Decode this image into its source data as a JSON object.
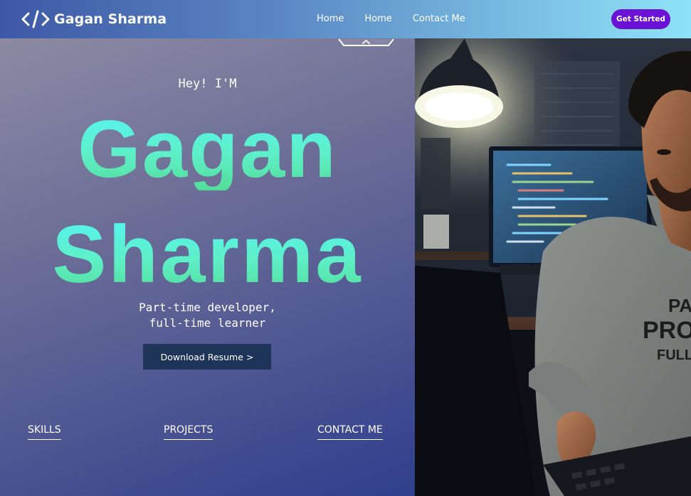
{
  "header": {
    "brand_name": "Gagan Sharma",
    "brand_icon": "code-brackets-icon",
    "nav_links": [
      "Home",
      "Home",
      "Contact Me"
    ],
    "cta_label": "Get Started",
    "cta_color": "#6b12d6"
  },
  "hero": {
    "greeting": "Hey! I'M",
    "first_name": "Gagan",
    "last_name": "Sharma",
    "tagline_line1": "Part-time developer,",
    "tagline_line2": "full-time learner",
    "download_label": "Download Resume >",
    "name_gradient": [
      "#55f3f2",
      "#53dc98"
    ]
  },
  "section_links": [
    "SKILLS",
    "PROJECTS",
    "CONTACT ME"
  ],
  "illustration": {
    "alt": "developer-at-desk-photo",
    "shirt_lines": [
      "PA",
      "PROG",
      "FULL-T"
    ]
  }
}
